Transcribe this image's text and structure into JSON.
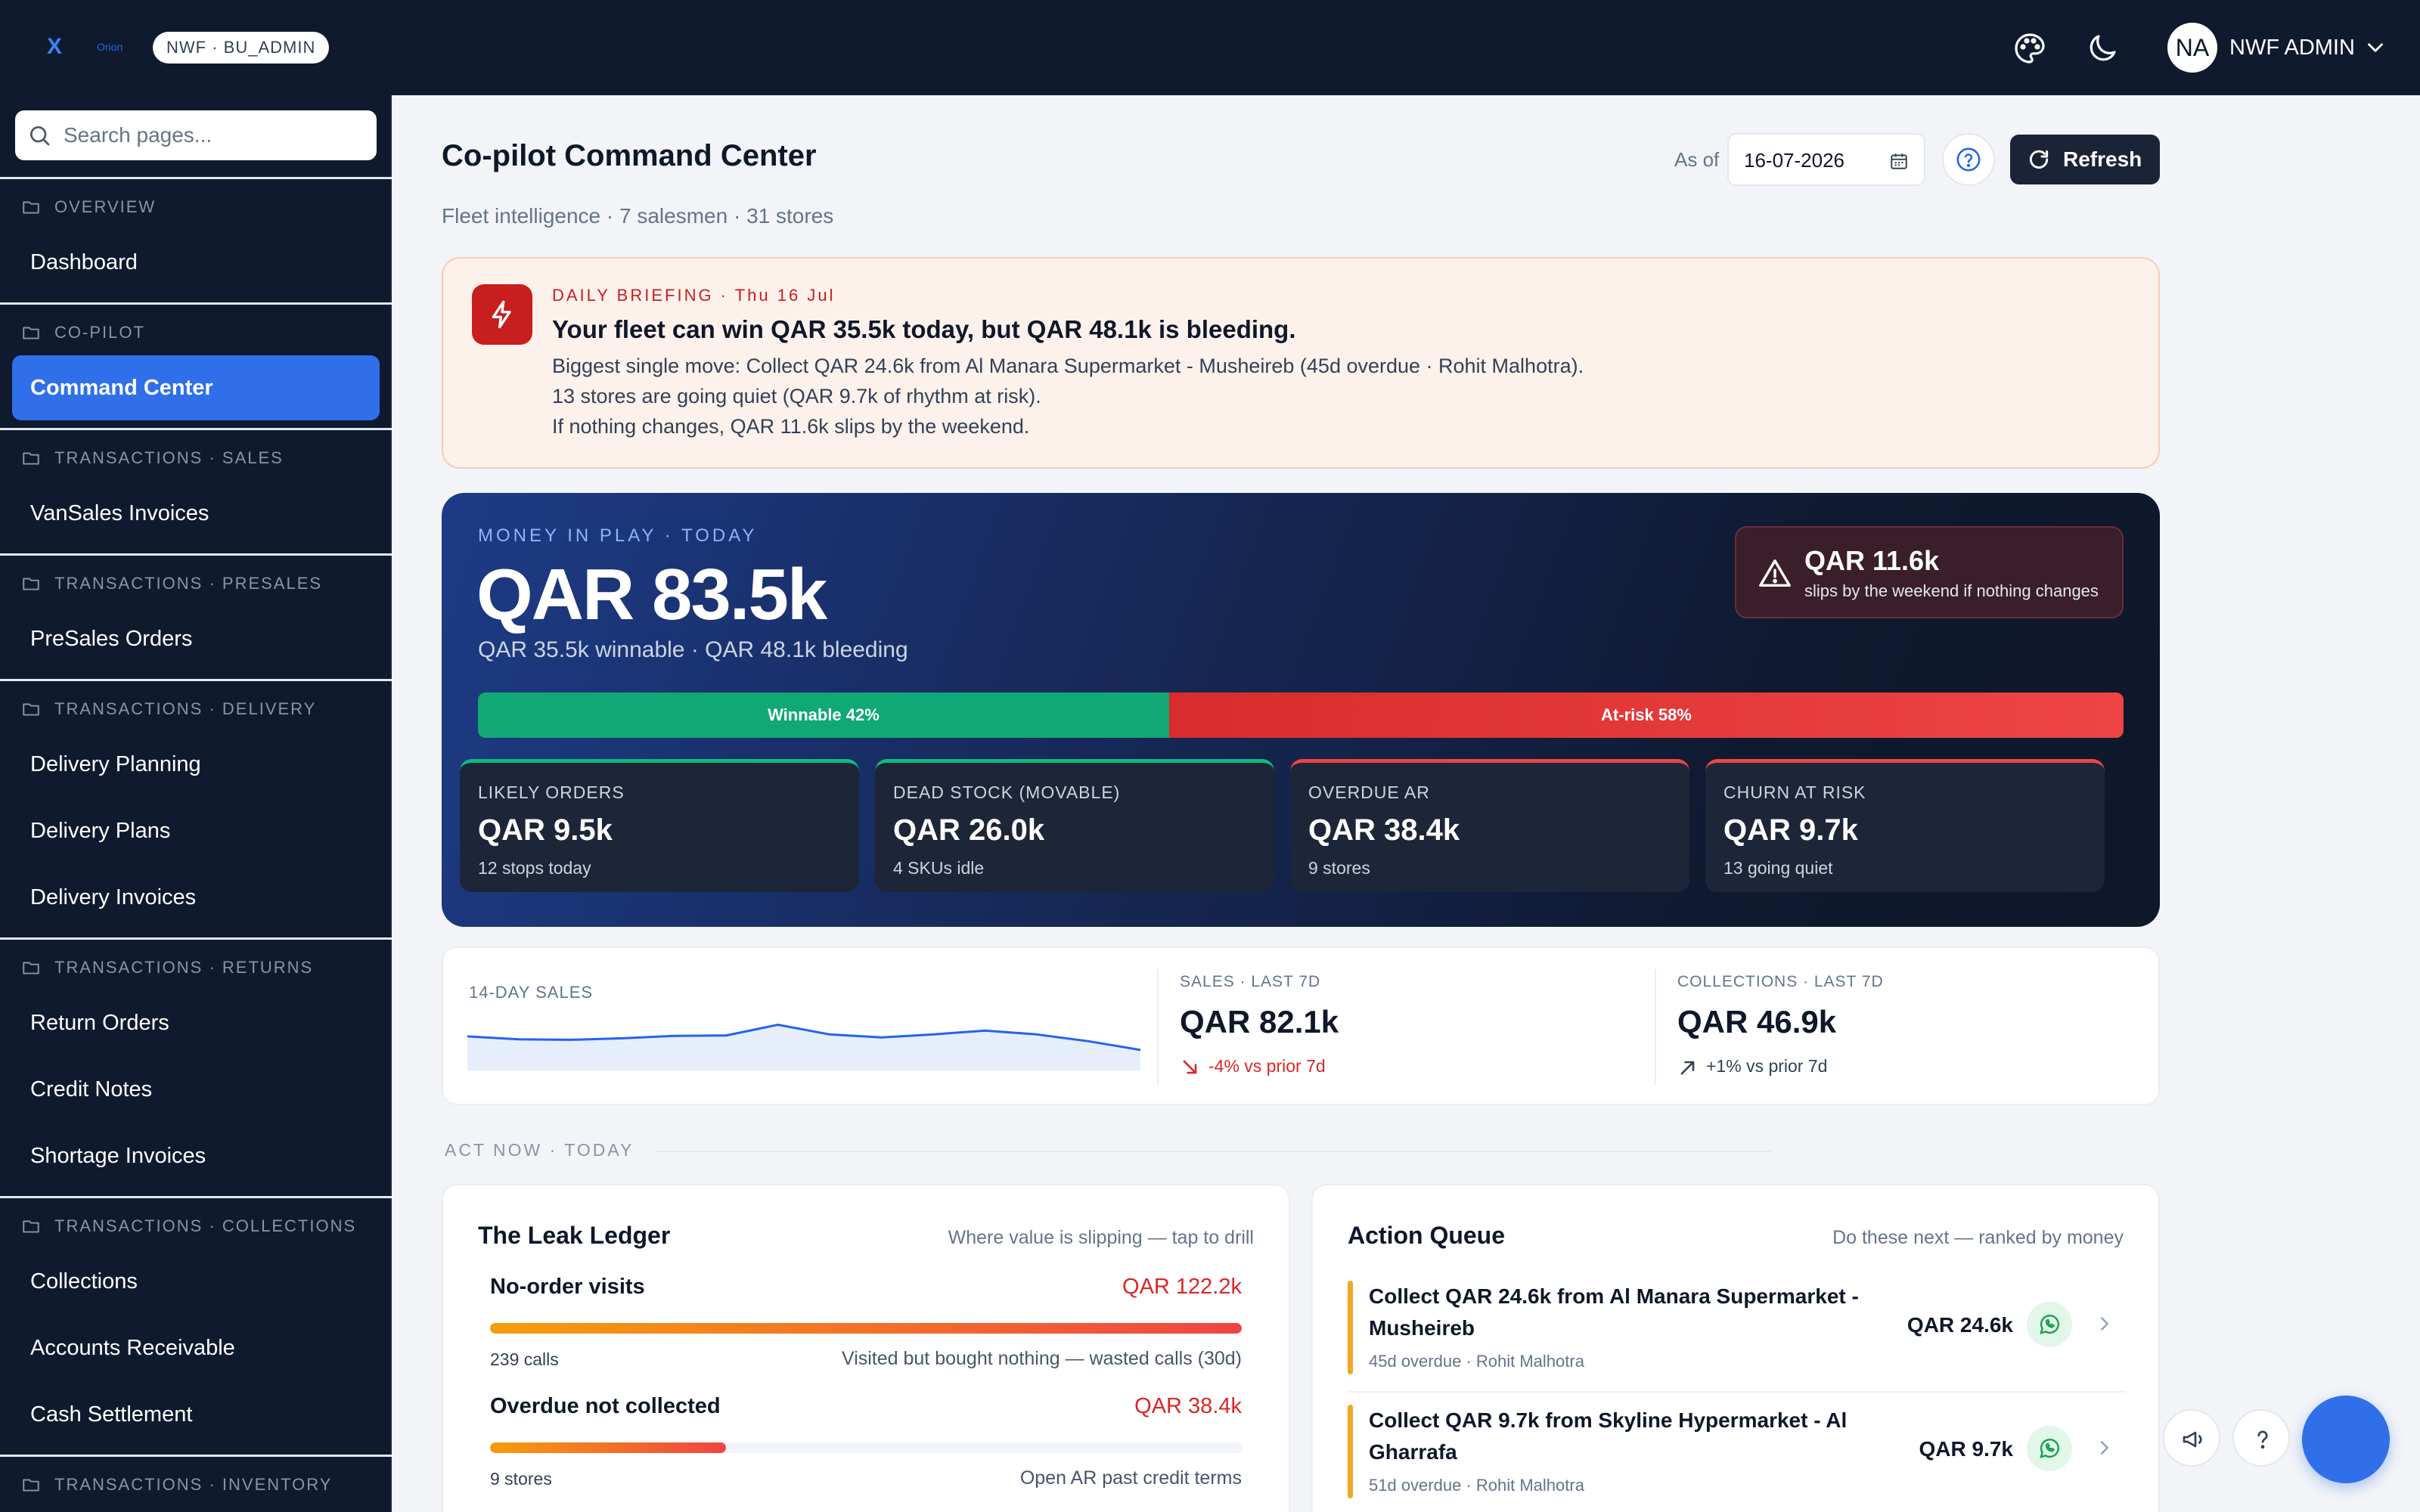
{
  "topbar": {
    "logo_mark": "X",
    "logo_word": "Orion",
    "role_badge": "NWF · BU_ADMIN",
    "icons": [
      "palette-icon",
      "moon-icon"
    ],
    "user": {
      "initials": "NA",
      "name": "NWF ADMIN"
    }
  },
  "sidebar": {
    "search_placeholder": "Search pages...",
    "sections": [
      {
        "title": "OVERVIEW",
        "items": [
          "Dashboard"
        ]
      },
      {
        "title": "CO-PILOT",
        "items": [
          "Command Center"
        ]
      },
      {
        "title": "TRANSACTIONS · SALES",
        "items": [
          "VanSales Invoices"
        ]
      },
      {
        "title": "TRANSACTIONS · PRESALES",
        "items": [
          "PreSales Orders"
        ]
      },
      {
        "title": "TRANSACTIONS · DELIVERY",
        "items": [
          "Delivery Planning",
          "Delivery Plans",
          "Delivery Invoices"
        ]
      },
      {
        "title": "TRANSACTIONS · RETURNS",
        "items": [
          "Return Orders",
          "Credit Notes",
          "Shortage Invoices"
        ]
      },
      {
        "title": "TRANSACTIONS · COLLECTIONS",
        "items": [
          "Collections",
          "Accounts Receivable",
          "Cash Settlement"
        ]
      },
      {
        "title": "TRANSACTIONS · INVENTORY",
        "items": []
      }
    ],
    "active_item": "Command Center"
  },
  "header": {
    "title": "Co-pilot Command Center",
    "subtitle": "Fleet intelligence · 7 salesmen · 31 stores",
    "as_of_label": "As of",
    "date": "16-07-2026",
    "refresh_label": "Refresh"
  },
  "briefing": {
    "kicker": "DAILY BRIEFING · Thu 16 Jul",
    "title": "Your fleet can win QAR 35.5k today, but QAR 48.1k is bleeding.",
    "lines": [
      "Biggest single move: Collect QAR 24.6k from Al Manara Supermarket - Musheireb (45d overdue · Rohit Malhotra).",
      "13 stores are going quiet (QAR 9.7k of rhythm at risk).",
      "If nothing changes, QAR 11.6k slips by the weekend."
    ],
    "accent": "#c81e1e"
  },
  "money": {
    "kicker": "MONEY IN PLAY · TODAY",
    "total": "QAR 83.5k",
    "sub": "QAR 35.5k winnable · QAR 48.1k bleeding",
    "alert": {
      "amount": "QAR 11.6k",
      "text": "slips by the weekend if nothing changes"
    },
    "split": {
      "winnable_label": "Winnable 42%",
      "winnable_pct": 42,
      "risk_label": "At-risk 58%",
      "risk_pct": 58
    },
    "kpis": [
      {
        "label": "LIKELY ORDERS",
        "value": "QAR 9.5k",
        "sub": "12 stops today",
        "tone": "green"
      },
      {
        "label": "DEAD STOCK (MOVABLE)",
        "value": "QAR 26.0k",
        "sub": "4 SKUs idle",
        "tone": "green"
      },
      {
        "label": "OVERDUE AR",
        "value": "QAR 38.4k",
        "sub": "9 stores",
        "tone": "red"
      },
      {
        "label": "CHURN AT RISK",
        "value": "QAR 9.7k",
        "sub": "13 going quiet",
        "tone": "red"
      }
    ]
  },
  "trend": {
    "label": "14-DAY SALES",
    "spark": [
      0.42,
      0.48,
      0.49,
      0.46,
      0.41,
      0.4,
      0.18,
      0.38,
      0.44,
      0.38,
      0.3,
      0.38,
      0.52,
      0.7
    ],
    "sales": {
      "label": "SALES · LAST 7D",
      "value": "QAR 82.1k",
      "delta": "-4% vs prior 7d",
      "color": "#dc2626"
    },
    "collections": {
      "label": "COLLECTIONS · LAST 7D",
      "value": "QAR 46.9k",
      "delta": "+1% vs prior 7d",
      "color": "#334155"
    }
  },
  "act_now": {
    "label": "ACT NOW · TODAY"
  },
  "leak_ledger": {
    "title": "The Leak Ledger",
    "hint": "Where value is slipping — tap to drill",
    "rows": [
      {
        "name": "No-order visits",
        "amount": "QAR 122.2k",
        "count": "239 calls",
        "desc": "Visited but bought nothing — wasted calls (30d)",
        "fill": 1.0
      },
      {
        "name": "Overdue not collected",
        "amount": "QAR 38.4k",
        "count": "9 stores",
        "desc": "Open AR past credit terms",
        "fill": 0.314
      }
    ]
  },
  "action_queue": {
    "title": "Action Queue",
    "hint": "Do these next — ranked by money",
    "items": [
      {
        "title": "Collect QAR 24.6k from Al Manara Supermarket - Musheireb",
        "meta": "45d overdue · Rohit Malhotra",
        "amount": "QAR 24.6k"
      },
      {
        "title": "Collect QAR 9.7k from Skyline Hypermarket - Al Gharrafa",
        "meta": "51d overdue · Rohit Malhotra",
        "amount": "QAR 9.7k"
      }
    ]
  }
}
